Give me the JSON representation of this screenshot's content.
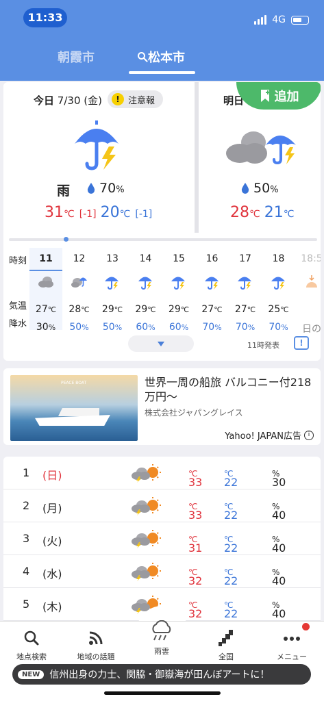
{
  "status_bar": {
    "time": "11:33",
    "network": "4G"
  },
  "tabs": [
    {
      "label": "朝霞市",
      "active": false
    },
    {
      "label": "松本市",
      "active": true
    }
  ],
  "today": {
    "date_prefix": "今日",
    "date": "7/30 (金)",
    "alert": "注意報",
    "weather": "雨",
    "precip": "70",
    "precip_unit": "%",
    "high": "31",
    "high_diff": "[-1]",
    "low": "20",
    "low_diff": "[-1]",
    "unit": "℃"
  },
  "tomorrow": {
    "date_prefix": "明日",
    "precip": "50",
    "precip_unit": "%",
    "high": "28",
    "low": "21",
    "unit": "℃",
    "add_label": "追加"
  },
  "hourly": {
    "labels": {
      "time": "時刻",
      "temp": "気温",
      "precip": "降水"
    },
    "hours": [
      {
        "hour": "11",
        "icon": "cloud-icon",
        "temp": "27",
        "precip": "30",
        "current": true
      },
      {
        "hour": "12",
        "icon": "cloud-rain-icon",
        "temp": "28",
        "precip": "50"
      },
      {
        "hour": "13",
        "icon": "umbrella-thunder-icon",
        "temp": "29",
        "precip": "50"
      },
      {
        "hour": "14",
        "icon": "umbrella-thunder-icon",
        "temp": "29",
        "precip": "60"
      },
      {
        "hour": "15",
        "icon": "umbrella-thunder-icon",
        "temp": "29",
        "precip": "60"
      },
      {
        "hour": "16",
        "icon": "umbrella-thunder-icon",
        "temp": "27",
        "precip": "70"
      },
      {
        "hour": "17",
        "icon": "umbrella-thunder-icon",
        "temp": "27",
        "precip": "70"
      },
      {
        "hour": "18",
        "icon": "umbrella-thunder-icon",
        "temp": "25",
        "precip": "70"
      }
    ],
    "sunset_label": "18:5",
    "sunset_text": "日の",
    "temp_unit": "℃",
    "precip_unit": "%",
    "issued": "11時発表"
  },
  "ad": {
    "title": "世界一周の船旅 バルコニー付218万円〜",
    "company": "株式会社ジャパングレイス",
    "label": "Yahoo! JAPAN広告",
    "image_caption": "PEACE BOAT"
  },
  "weekly": [
    {
      "day": "1",
      "dow": "(日)",
      "sunday": true,
      "high": "33",
      "low": "22",
      "precip": "30"
    },
    {
      "day": "2",
      "dow": "(月)",
      "high": "33",
      "low": "22",
      "precip": "40"
    },
    {
      "day": "3",
      "dow": "(火)",
      "high": "31",
      "low": "22",
      "precip": "40"
    },
    {
      "day": "4",
      "dow": "(水)",
      "high": "32",
      "low": "22",
      "precip": "40"
    },
    {
      "day": "5",
      "dow": "(木)",
      "high": "32",
      "low": "22",
      "precip": "40"
    }
  ],
  "bottom_nav": [
    {
      "label": "地点検索",
      "icon": "search-icon"
    },
    {
      "label": "地域の話題",
      "icon": "rss-icon"
    },
    {
      "label": "雨雲",
      "icon": "rain-cloud-icon"
    },
    {
      "label": "全国",
      "icon": "japan-map-icon"
    },
    {
      "label": "メニュー",
      "icon": "more-icon"
    }
  ],
  "ticker": {
    "badge": "NEW",
    "text": "信州出身の力士、関脇・御嶽海が田んぼアートに！"
  },
  "colors": {
    "header": "#5a8fe3",
    "high": "#e0333c",
    "low": "#3a74d8",
    "add": "#4db96a"
  }
}
